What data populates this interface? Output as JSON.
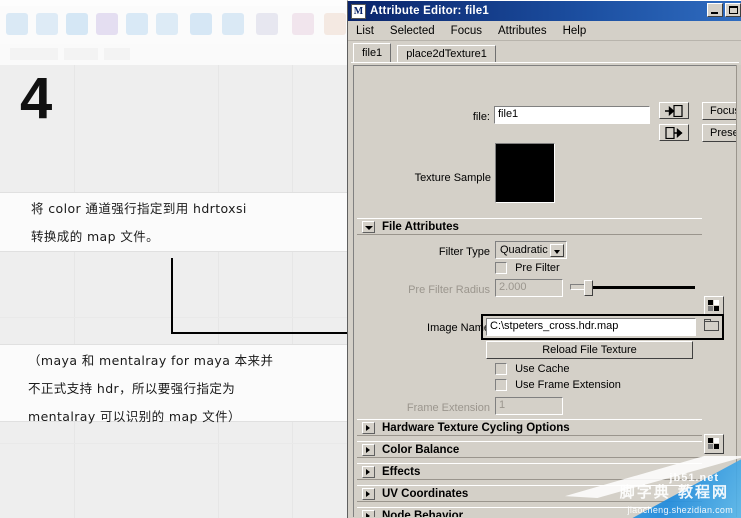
{
  "tutorial": {
    "step_number": "4",
    "note_line1": "将 color 通道强行指定到用 hdrtoxsi",
    "note_line2": "转换成的 map 文件。",
    "paren_line1": "（maya 和 mentalray for maya 本来并",
    "paren_line2": "不正式支持 hdr，所以要强行指定为",
    "paren_line3": "mentalray 可以识别的 map 文件）"
  },
  "watermark": {
    "en": "jb51.net",
    "cn": "脚字典 教程网",
    "url": "jiaocheng.shezidian.com"
  },
  "window": {
    "title": "Attribute Editor: file1",
    "icon": "maya-logo-icon",
    "minimize": "minimize-button",
    "maximize": "maximize-button",
    "menus": [
      "List",
      "Selected",
      "Focus",
      "Attributes",
      "Help"
    ]
  },
  "tabs": [
    {
      "label": "file1",
      "active": true
    },
    {
      "label": "place2dTexture1",
      "active": false
    }
  ],
  "top_row": {
    "file_label": "file:",
    "file_value": "file1",
    "focus_button": "Focus",
    "presets_button": "Presets",
    "load_icon": "arrow-into-box-icon",
    "save_icon": "arrow-out-of-box-icon"
  },
  "texture_sample": {
    "label": "Texture Sample",
    "color": "#000000"
  },
  "sections": [
    {
      "name": "file-attributes",
      "title": "File Attributes",
      "expanded": true
    },
    {
      "name": "hardware-texture-cycling-options",
      "title": "Hardware Texture Cycling Options",
      "expanded": false
    },
    {
      "name": "color-balance",
      "title": "Color Balance",
      "expanded": false
    },
    {
      "name": "effects",
      "title": "Effects",
      "expanded": false
    },
    {
      "name": "uv-coordinates",
      "title": "UV Coordinates",
      "expanded": false
    },
    {
      "name": "node-behavior",
      "title": "Node Behavior",
      "expanded": false
    }
  ],
  "file_attributes": {
    "filter_type_label": "Filter Type",
    "filter_type_value": "Quadratic",
    "pre_filter_label": "Pre Filter",
    "pre_filter_checked": false,
    "pre_filter_radius_label": "Pre Filter Radius",
    "pre_filter_radius_value": "2.000",
    "pre_filter_radius_disabled": true,
    "image_name_label": "Image Name",
    "image_name_value": "C:\\stpeters_cross.hdr.map",
    "image_name_highlighted": true,
    "browse_icon": "folder-icon",
    "reload_button": "Reload File Texture",
    "use_cache_label": "Use Cache",
    "use_cache_checked": false,
    "use_frame_extension_label": "Use Frame Extension",
    "use_frame_extension_checked": false,
    "frame_extension_label": "Frame Extension",
    "frame_extension_value": "1",
    "frame_extension_disabled": true
  },
  "colors": {
    "window_face": "#d4d0c8",
    "titlebar_start": "#0a246a",
    "titlebar_end": "#2f6cc0",
    "field_bg": "#ffffff",
    "left_bg": "#eeeeee",
    "watermark_blue": "#2b8cdc"
  }
}
